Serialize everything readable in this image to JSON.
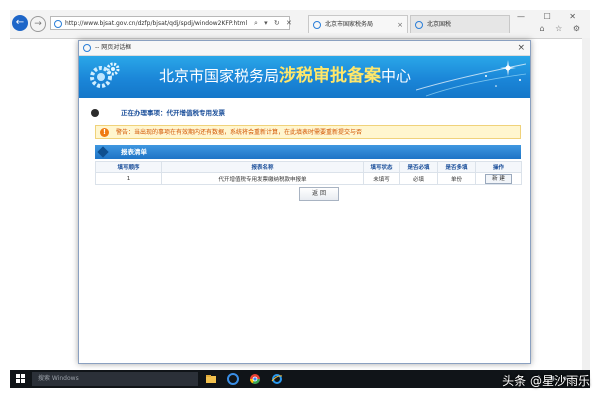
{
  "browser": {
    "url": "http://www.bjsat.gov.cn/dzfp/bjsat/qdj/spdj/window2KFP.html",
    "tabs": [
      {
        "label": "北京市国家税务局"
      },
      {
        "label": "北京国税"
      }
    ],
    "back_glyph": "←",
    "forward_glyph": "→",
    "address_tools": "⌕ ▾ ↻ ✕",
    "window_controls": "— ☐ ✕",
    "toolbar_icons": "⌂ ☆ ⚙"
  },
  "modal": {
    "title": "-- 网页对话框",
    "close_glyph": "×",
    "banner": {
      "prefix": "北京市国家税务局",
      "highlight": "涉税审批备案",
      "suffix": "中心"
    },
    "status": "正在办理事项：代开增值税专用发票",
    "warning": "警告：当出现的事项在有效期内还有数据，系统将会重新计算，在此填表时需要重新提交与否",
    "warning_glyph": "!",
    "list_title": "报表清单",
    "table": {
      "headers": [
        "填写顺序",
        "报表名称",
        "填写状态",
        "是否必填",
        "是否多填",
        "操作"
      ],
      "rows": [
        {
          "order": "1",
          "name": "代开增值税专用发票缴纳税款申报单",
          "status": "未填写",
          "required": "必填",
          "multi": "单份",
          "action": "新 建"
        }
      ]
    },
    "back_button": "返 回"
  },
  "taskbar": {
    "search_placeholder": "搜索 Windows",
    "tray": "^ ■ ◆ ♪"
  },
  "watermark": "头条 @星沙雨乐",
  "colors": {
    "banner_blue": "#1b86d8",
    "banner_highlight": "#ffe76a",
    "warning_text": "#d25400",
    "header_blue": "#1f74c6"
  }
}
